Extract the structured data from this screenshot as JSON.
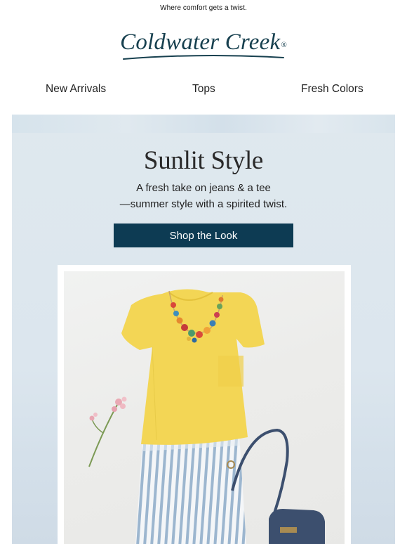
{
  "preheader": "Where comfort gets a twist.",
  "brand": {
    "name": "Coldwater Creek",
    "reg_mark": "®",
    "color": "#17404f"
  },
  "nav": [
    {
      "label": "New Arrivals"
    },
    {
      "label": "Tops"
    },
    {
      "label": "Fresh Colors"
    }
  ],
  "hero": {
    "title": "Sunlit Style",
    "subtitle_line1": "A fresh take on jeans & a tee",
    "subtitle_line2": "—summer style with a spirited twist.",
    "cta_label": "Shop the Look",
    "cta_color": "#0d3b53"
  },
  "photo": {
    "items": [
      "yellow-tee",
      "beaded-necklace",
      "striped-jeans",
      "pink-flower",
      "navy-crossbody-bag"
    ],
    "tee_color": "#f3d655",
    "bag_color": "#3c4f6e"
  }
}
